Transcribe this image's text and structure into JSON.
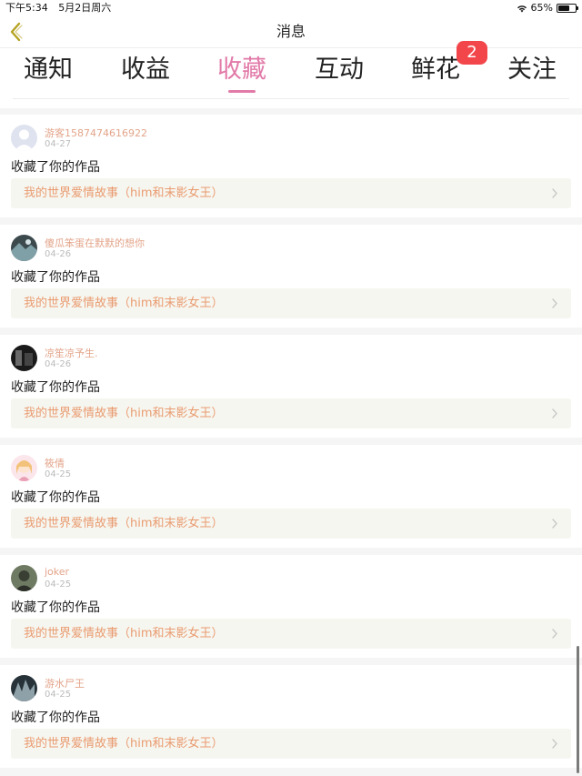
{
  "status": {
    "time": "下午5:34",
    "date": "5月2日周六",
    "battery": "65%",
    "battery_level": 0.65
  },
  "nav": {
    "title": "消息"
  },
  "tabs": [
    {
      "label": "通知"
    },
    {
      "label": "收益"
    },
    {
      "label": "收藏",
      "active": true
    },
    {
      "label": "互动"
    },
    {
      "label": "鲜花",
      "badge": "2"
    },
    {
      "label": "关注"
    }
  ],
  "colors": {
    "accent": "#e27aa8",
    "badge": "#f2464a",
    "username": "#e3a48a",
    "work": "#e99b70"
  },
  "items": [
    {
      "username": "游客1587474616922",
      "date": "04-27",
      "action": "收藏了你的作品",
      "work": "我的世界爱情故事（him和末影女王）",
      "avatar": "default-avatar"
    },
    {
      "username": "傻瓜笨蛋在默默的想你",
      "date": "04-26",
      "action": "收藏了你的作品",
      "work": "我的世界爱情故事（him和末影女王）",
      "avatar": "photo-avatar"
    },
    {
      "username": "凉笙凉予生.",
      "date": "04-26",
      "action": "收藏了你的作品",
      "work": "我的世界爱情故事（him和末影女王）",
      "avatar": "photo-avatar"
    },
    {
      "username": "筱倩",
      "date": "04-25",
      "action": "收藏了你的作品",
      "work": "我的世界爱情故事（him和末影女王）",
      "avatar": "anime-avatar"
    },
    {
      "username": "joker",
      "date": "04-25",
      "action": "收藏了你的作品",
      "work": "我的世界爱情故事（him和末影女王）",
      "avatar": "photo-avatar"
    },
    {
      "username": "游水尸王",
      "date": "04-25",
      "action": "收藏了你的作品",
      "work": "我的世界爱情故事（him和末影女王）",
      "avatar": "photo-avatar"
    }
  ]
}
